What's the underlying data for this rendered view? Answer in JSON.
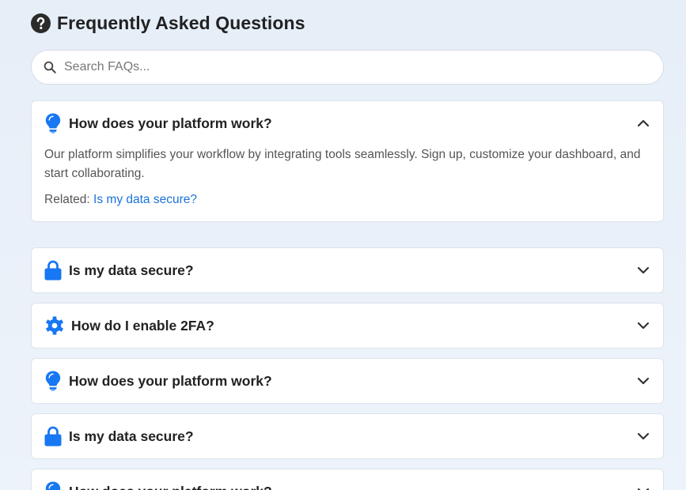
{
  "header": {
    "title": "Frequently Asked Questions",
    "icon": "question-circle-icon"
  },
  "search": {
    "placeholder": "Search FAQs...",
    "value": "",
    "icon": "search-icon"
  },
  "colors": {
    "accent": "#1a73e8",
    "link": "#1a73d8",
    "icon_blue": "#1877f2"
  },
  "faqs": [
    {
      "icon": "lightbulb-icon",
      "question": "How does your platform work?",
      "expanded": true,
      "answer": "Our platform simplifies your workflow by integrating tools seamlessly. Sign up, customize your dashboard, and start collaborating.",
      "related_label": "Related:",
      "related_link": "Is my data secure?"
    },
    {
      "icon": "lock-icon",
      "question": "Is my data secure?",
      "expanded": false
    },
    {
      "icon": "gear-icon",
      "question": "How do I enable 2FA?",
      "expanded": false
    },
    {
      "icon": "lightbulb-icon",
      "question": "How does your platform work?",
      "expanded": false
    },
    {
      "icon": "lock-icon",
      "question": "Is my data secure?",
      "expanded": false
    },
    {
      "icon": "lightbulb-icon",
      "question": "How does your platform work?",
      "expanded": false
    }
  ]
}
